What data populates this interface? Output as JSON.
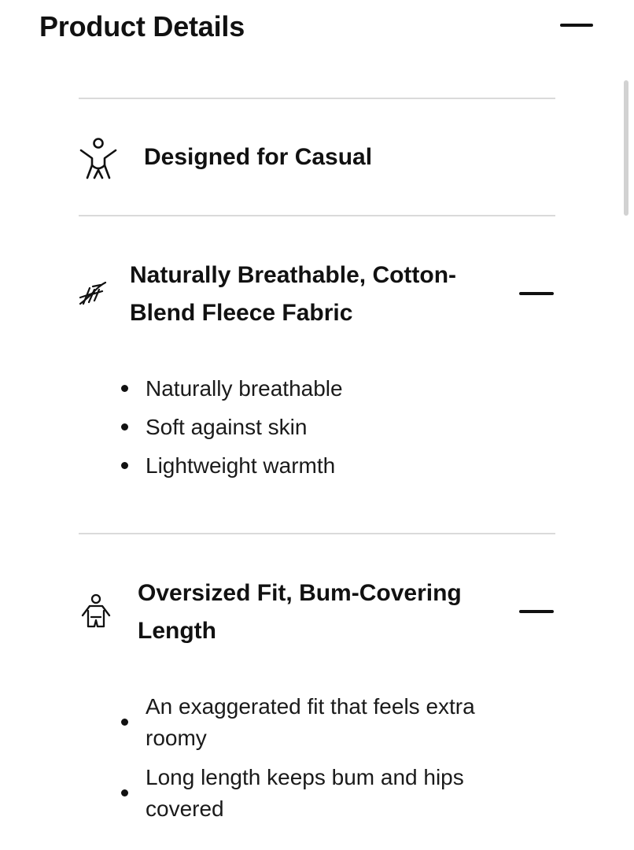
{
  "header": {
    "title": "Product Details"
  },
  "features": [
    {
      "icon": "person-stretch-icon",
      "title": "Designed for Casual"
    },
    {
      "icon": "fabric-weave-icon",
      "title_line1": "Naturally Breathable, Cotton-",
      "title_line2": "Blend Fleece Fabric",
      "bullets": [
        "Naturally breathable",
        "Soft against skin",
        "Lightweight warmth"
      ]
    },
    {
      "icon": "oversized-fit-icon",
      "title_line1": "Oversized Fit, Bum-Covering",
      "title_line2": "Length",
      "bullets": [
        {
          "line1": "An exaggerated fit that feels extra",
          "line2": "roomy"
        },
        {
          "line1": "Long length keeps bum and hips",
          "line2": "covered"
        }
      ]
    }
  ],
  "colors": {
    "text": "#111111",
    "divider": "#dadada",
    "scrollbar": "#d2d2d2"
  }
}
